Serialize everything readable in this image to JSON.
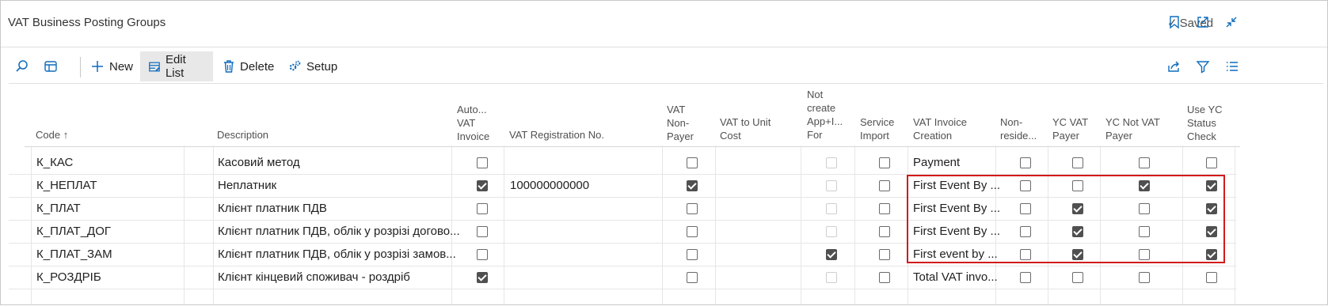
{
  "window": {
    "title": "VAT Business Posting Groups",
    "saved_label": "Saved"
  },
  "actions": {
    "new": "New",
    "edit_list": "Edit List",
    "delete": "Delete",
    "setup": "Setup"
  },
  "columns": {
    "code": "Code",
    "sort_arrow": "↑",
    "description": "Description",
    "auto_vat_invoice": [
      "Auto...",
      "VAT",
      "Invoice"
    ],
    "vat_registration_no": "VAT Registration No.",
    "vat_non_payer": [
      "VAT",
      "Non-",
      "Payer"
    ],
    "vat_to_unit_cost": [
      "VAT to Unit",
      "Cost"
    ],
    "not_create_app": [
      "Not",
      "create",
      "App+I...",
      "For"
    ],
    "service_import": [
      "Service",
      "Import"
    ],
    "vat_invoice_creation": [
      "VAT Invoice",
      "Creation"
    ],
    "non_resident": [
      "Non-",
      "reside..."
    ],
    "yc_vat_payer": [
      "YC VAT",
      "Payer"
    ],
    "yc_not_vat_payer": [
      "YC Not VAT",
      "Payer"
    ],
    "use_yc_status_check": [
      "Use YC",
      "Status",
      "Check"
    ]
  },
  "rows": [
    {
      "code": "К_КАС",
      "description": "Касовий метод",
      "auto_vat_invoice": false,
      "vat_registration_no": "",
      "vat_non_payer": false,
      "not_create_app": false,
      "service_import": false,
      "vat_invoice_creation": "Payment",
      "non_resident": false,
      "yc_vat_payer": false,
      "yc_not_vat_payer": false,
      "use_yc_status_check": false
    },
    {
      "code": "К_НЕПЛАТ",
      "description": "Неплатник",
      "auto_vat_invoice": true,
      "vat_registration_no": "100000000000",
      "vat_non_payer": true,
      "not_create_app": false,
      "service_import": false,
      "vat_invoice_creation": "First Event By ...",
      "non_resident": false,
      "yc_vat_payer": false,
      "yc_not_vat_payer": true,
      "use_yc_status_check": true
    },
    {
      "code": "К_ПЛАТ",
      "description": "Клієнт платник ПДВ",
      "auto_vat_invoice": false,
      "vat_registration_no": "",
      "vat_non_payer": false,
      "not_create_app": false,
      "service_import": false,
      "vat_invoice_creation": "First Event By ...",
      "non_resident": false,
      "yc_vat_payer": true,
      "yc_not_vat_payer": false,
      "use_yc_status_check": true
    },
    {
      "code": "К_ПЛАТ_ДОГ",
      "description": "Клієнт платник ПДВ, облік у розрізі догово...",
      "auto_vat_invoice": false,
      "vat_registration_no": "",
      "vat_non_payer": false,
      "not_create_app": false,
      "service_import": false,
      "vat_invoice_creation": "First Event By ...",
      "non_resident": false,
      "yc_vat_payer": true,
      "yc_not_vat_payer": false,
      "use_yc_status_check": true
    },
    {
      "code": "К_ПЛАТ_ЗАМ",
      "description": "Клієнт платник ПДВ, облік у розрізі замов...",
      "auto_vat_invoice": false,
      "vat_registration_no": "",
      "vat_non_payer": false,
      "not_create_app": true,
      "service_import": false,
      "vat_invoice_creation": "First event by ...",
      "non_resident": false,
      "yc_vat_payer": true,
      "yc_not_vat_payer": false,
      "use_yc_status_check": true
    },
    {
      "code": "К_РОЗДРІБ",
      "description": "Клієнт кінцевий споживач - роздріб",
      "auto_vat_invoice": true,
      "vat_registration_no": "",
      "vat_non_payer": false,
      "not_create_app": false,
      "service_import": false,
      "vat_invoice_creation": "Total VAT invo...",
      "non_resident": false,
      "yc_vat_payer": false,
      "yc_not_vat_payer": false,
      "use_yc_status_check": false
    }
  ],
  "icons": {
    "search": "search-icon",
    "layout": "layout-icon",
    "new": "plus-icon",
    "edit_list": "edit-list-icon",
    "delete": "trash-icon",
    "setup": "gear-icon",
    "bookmark": "bookmark-icon",
    "open_new": "open-in-new-window-icon",
    "collapse": "collapse-icon",
    "share": "share-icon",
    "filter": "filter-icon",
    "list_view": "list-view-icon"
  },
  "colors": {
    "highlight_box": "#d11a1a",
    "selected_action_bg": "#e8e8e8",
    "brand": "#0f6cbd"
  }
}
